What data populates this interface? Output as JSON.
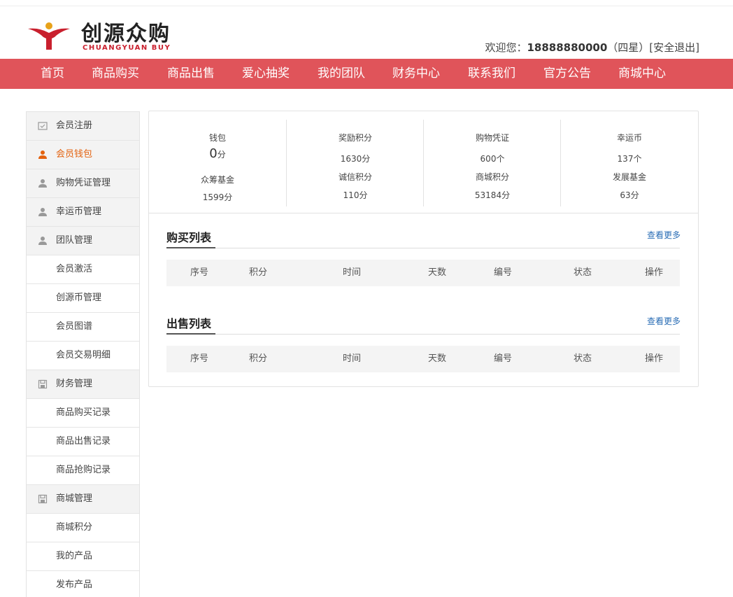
{
  "brand": {
    "name_cn": "创源众购",
    "name_en": "CHUANGYUAN BUY",
    "colors": {
      "accent": "#e0545a",
      "logo_red": "#c9202e",
      "active": "#e3620f",
      "link": "#2a6db5"
    }
  },
  "header": {
    "welcome_prefix": "欢迎您：",
    "phone": "18888880000",
    "level": "（四星）",
    "logout": "[安全退出]"
  },
  "nav": {
    "items": [
      {
        "label": "首页"
      },
      {
        "label": "商品购买"
      },
      {
        "label": "商品出售"
      },
      {
        "label": "爱心抽奖"
      },
      {
        "label": "我的团队"
      },
      {
        "label": "财务中心"
      },
      {
        "label": "联系我们"
      },
      {
        "label": "官方公告"
      },
      {
        "label": "商城中心"
      }
    ]
  },
  "sidebar": {
    "items": [
      {
        "label": "会员注册",
        "type": "group",
        "icon": "register-icon"
      },
      {
        "label": "会员钱包",
        "type": "group",
        "icon": "user-icon",
        "active": true
      },
      {
        "label": "购物凭证管理",
        "type": "group",
        "icon": "user-icon"
      },
      {
        "label": "幸运币管理",
        "type": "group",
        "icon": "user-icon"
      },
      {
        "label": "团队管理",
        "type": "group",
        "icon": "user-icon"
      },
      {
        "label": "会员激活",
        "type": "sub"
      },
      {
        "label": "创源币管理",
        "type": "sub"
      },
      {
        "label": "会员图谱",
        "type": "sub"
      },
      {
        "label": "会员交易明细",
        "type": "sub"
      },
      {
        "label": "财务管理",
        "type": "group",
        "icon": "save-icon"
      },
      {
        "label": "商品购买记录",
        "type": "sub"
      },
      {
        "label": "商品出售记录",
        "type": "sub"
      },
      {
        "label": "商品抢购记录",
        "type": "sub"
      },
      {
        "label": "商城管理",
        "type": "group",
        "icon": "save-icon"
      },
      {
        "label": "商城积分",
        "type": "sub"
      },
      {
        "label": "我的产品",
        "type": "sub"
      },
      {
        "label": "发布产品",
        "type": "sub"
      }
    ]
  },
  "stats": [
    {
      "label1": "钱包",
      "value1_num": "0",
      "value1_unit": "分",
      "label2": "众筹基金",
      "value2": "1599分"
    },
    {
      "label1": "奖励积分",
      "value1": "1630分",
      "label2": "诚信积分",
      "value2": "110分"
    },
    {
      "label1": "购物凭证",
      "value1": "600个",
      "label2": "商城积分",
      "value2": "53184分"
    },
    {
      "label1": "幸运币",
      "value1": "137个",
      "label2": "发展基金",
      "value2": "63分"
    }
  ],
  "buy_list": {
    "title": "购买列表",
    "more": "查看更多"
  },
  "sell_list": {
    "title": "出售列表",
    "more": "查看更多"
  },
  "table_columns": [
    "序号",
    "积分",
    "时间",
    "天数",
    "编号",
    "状态",
    "操作"
  ]
}
